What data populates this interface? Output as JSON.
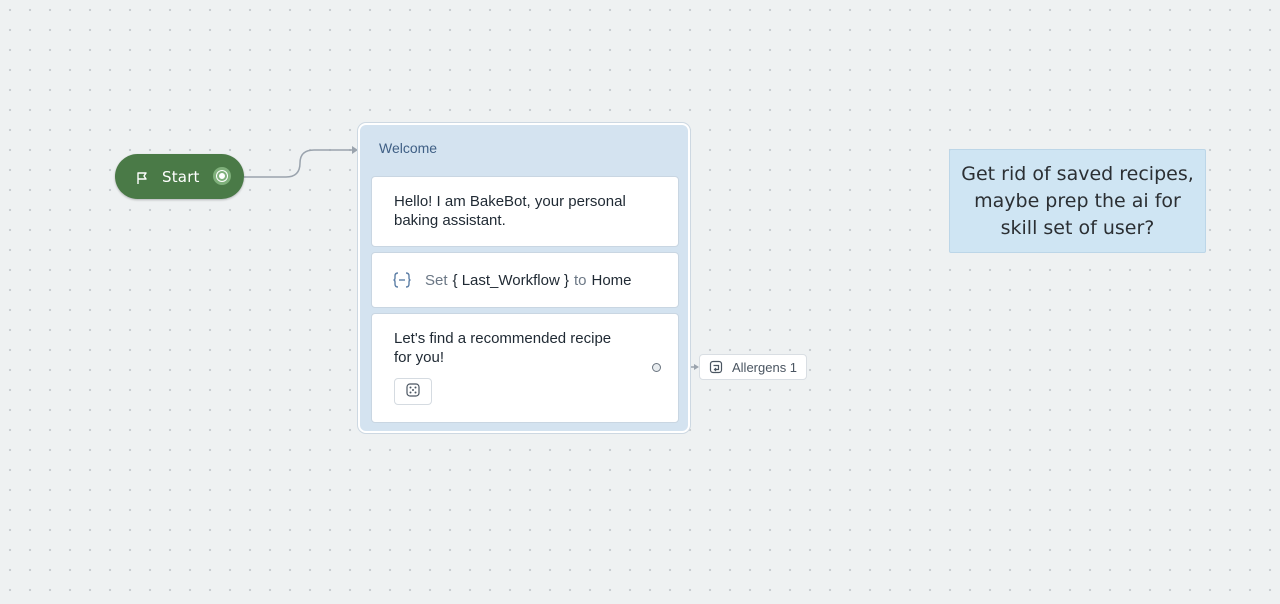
{
  "canvas": {
    "background": "#eef1f2"
  },
  "start_node": {
    "label": "Start",
    "icon": "flag-icon",
    "color": "#4a7a47"
  },
  "welcome_block": {
    "title": "Welcome",
    "steps": [
      {
        "type": "text",
        "text": "Hello! I am BakeBot, your personal baking assistant."
      },
      {
        "type": "set-variable",
        "icon": "variable-icon",
        "set_label": "Set",
        "variable": "{ Last_Workflow }",
        "to_label": "to",
        "value": "Home"
      },
      {
        "type": "text",
        "text": "Let's find a recommended recipe for you!",
        "button_icon": "dice-icon"
      }
    ]
  },
  "link_chip": {
    "icon": "link-block-icon",
    "label": "Allergens 1"
  },
  "sticky_note": {
    "text": "Get rid of saved recipes, maybe prep the ai for skill set of user?",
    "color": "#cfe5f3"
  }
}
